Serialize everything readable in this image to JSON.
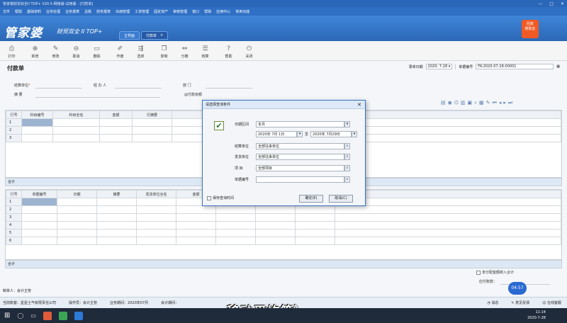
{
  "window": {
    "title": "管家婆财贸双全II TOP+ V20.5-网络版-试用版 - [付款单]",
    "controls": [
      "—",
      "□",
      "✕"
    ]
  },
  "menubar": [
    "文件",
    "帮助",
    "基础资料",
    "业务处理",
    "业务报表",
    "总账",
    "财务报表",
    "出纳管理",
    "工资管理",
    "固定资产",
    "审核管理",
    "窗口",
    "帮助",
    "应用中心",
    "常用功能"
  ],
  "brand": {
    "logo": "管家婆",
    "subtitle": "财贸双全 II TOP+",
    "badge_top": "回家",
    "badge_bottom": "搜职友"
  },
  "tabs": [
    {
      "label": "主界面"
    },
    {
      "label": "付款单",
      "close": "×"
    }
  ],
  "toolbar": [
    {
      "label": "打印",
      "icon": "printer-icon",
      "glyph": "⎙"
    },
    {
      "label": "新增",
      "icon": "new-icon",
      "glyph": "⊕"
    },
    {
      "label": "修改",
      "icon": "edit-icon",
      "glyph": "✎"
    },
    {
      "label": "取消",
      "icon": "cancel-icon",
      "glyph": "⊖"
    },
    {
      "label": "删除",
      "icon": "delete-icon",
      "glyph": "▭"
    },
    {
      "label": "作废",
      "icon": "void-icon",
      "glyph": "✐"
    },
    {
      "label": "选单",
      "icon": "select-doc-icon",
      "glyph": "⇶"
    },
    {
      "label": "复制",
      "icon": "copy-icon",
      "glyph": "❐"
    },
    {
      "label": "分摊",
      "icon": "allocate-icon",
      "glyph": "⇔"
    },
    {
      "label": "核算",
      "icon": "reconcile-icon",
      "glyph": "☰"
    },
    {
      "label": "帮助",
      "icon": "help-icon",
      "glyph": "?"
    },
    {
      "label": "关闭",
      "icon": "power-icon",
      "glyph": "⏻"
    }
  ],
  "form": {
    "title": "付款单",
    "date_label": "录单日期",
    "date_value": "2020- 7-28",
    "number_label": "单据编号",
    "number_value": "FK-2020-07-28-00001",
    "settle_unit_label": "结算单位",
    "handler_label": "经 办 人",
    "department_label": "部 门",
    "summary_label": "摘 要",
    "attach_label": "@付款余额"
  },
  "grid_top": {
    "headers": [
      "行号",
      "科目编号",
      "科目全名",
      "金额",
      "行摘要"
    ],
    "rows": [
      "1",
      "2",
      "3"
    ],
    "total_label": "合计"
  },
  "grid_bottom": {
    "headers": [
      "行号",
      "单据编号",
      "日期",
      "摘要",
      "发货单位全名",
      "金额",
      "",
      "",
      ""
    ],
    "rows": [
      "1",
      "2",
      "3",
      "4",
      "5",
      "6"
    ],
    "total_label": "合计"
  },
  "bottom_right": {
    "checkbox_label": "未分配金额转入合计",
    "amount_label": "应付账款："
  },
  "maker": "制单人：会计主管",
  "status": {
    "company": "当前账套：星星士气有限责任公司",
    "operator": "操作员：会计主管",
    "period": "业务期间：2020年07月",
    "account": "会计期间：",
    "message": "消息",
    "feedback": "意见反馈",
    "service": "在线客服"
  },
  "time_bubble": "04:57",
  "subtitle": "移动平均等）",
  "clock": {
    "time": "11:14",
    "date": "2020-7-28"
  },
  "dialog": {
    "title": "请选择查询条件",
    "date_range_label": "日期区间",
    "date_range_value": "本月",
    "start_date": "2020年 7月 1日",
    "to": "至",
    "end_date": "2020年 7月29日",
    "settle_label": "结算单位",
    "settle_value": "全部往来单位",
    "supplier_label": "发货单位",
    "supplier_value": "全部往来单位",
    "subject_label": "项  目",
    "subject_value": "全部项目",
    "docno_label": "单据编号",
    "docno_value": "",
    "remember_label": "保存查询时间",
    "ok_label": "确定(E)",
    "cancel_label": "取消(C)",
    "check_glyph": "✔"
  }
}
